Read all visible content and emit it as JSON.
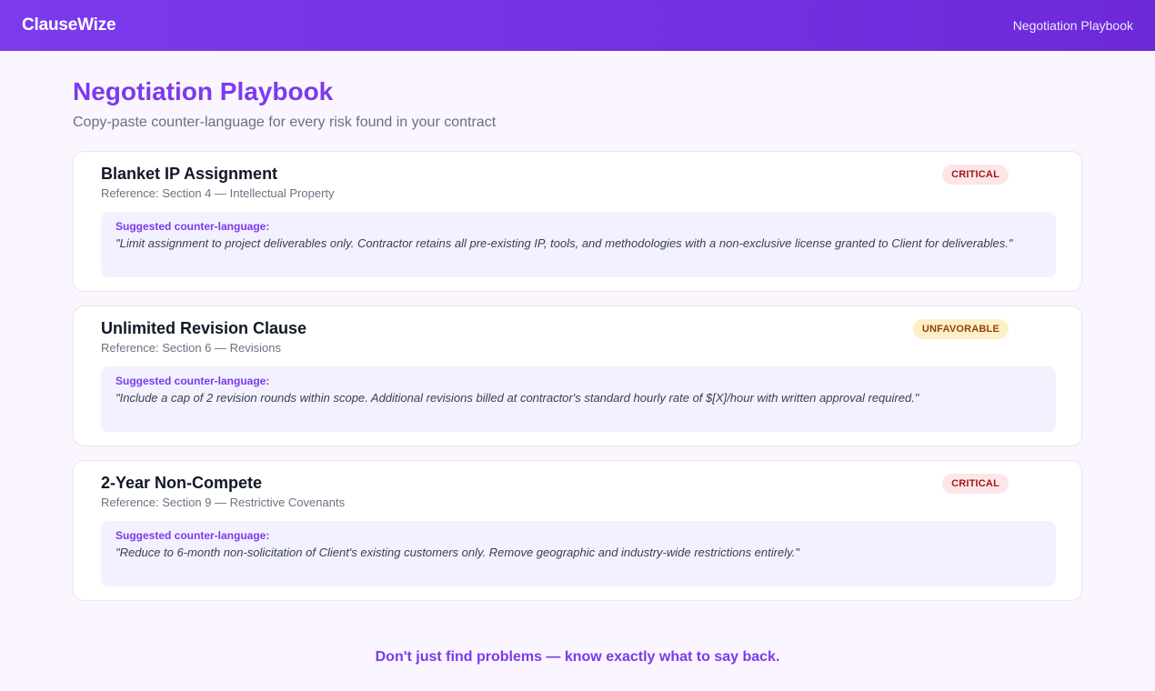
{
  "header": {
    "brand": "ClauseWize",
    "nav_link": "Negotiation Playbook"
  },
  "page": {
    "title": "Negotiation Playbook",
    "subtitle": "Copy-paste counter-language for every risk found in your contract"
  },
  "cards": [
    {
      "title": "Blanket IP Assignment",
      "reference": "Reference: Section 4 — Intellectual Property",
      "badge": "CRITICAL",
      "suggest_label": "Suggested counter-language:",
      "suggest_text": "\"Limit assignment to project deliverables only. Contractor retains all pre-existing IP, tools, and methodologies with a non-exclusive license granted to Client for deliverables.\""
    },
    {
      "title": "Unlimited Revision Clause",
      "reference": "Reference: Section 6 — Revisions",
      "badge": "UNFAVORABLE",
      "suggest_label": "Suggested counter-language:",
      "suggest_text": "\"Include a cap of 2 revision rounds within scope. Additional revisions billed at contractor's standard hourly rate of $[X]/hour with written approval required.\""
    },
    {
      "title": "2-Year Non-Compete",
      "reference": "Reference: Section 9 — Restrictive Covenants",
      "badge": "CRITICAL",
      "suggest_label": "Suggested counter-language:",
      "suggest_text": "\"Reduce to 6-month non-solicitation of Client's existing customers only. Remove geographic and industry-wide restrictions entirely.\""
    }
  ],
  "footer": {
    "tagline": "Don't just find problems — know exactly what to say back."
  },
  "colors": {
    "brand_purple": "#7c3aed",
    "critical_bg": "#fde6e8",
    "critical_text": "#991b1b",
    "unfavorable_bg": "#fdf0c7",
    "unfavorable_text": "#92400e"
  }
}
